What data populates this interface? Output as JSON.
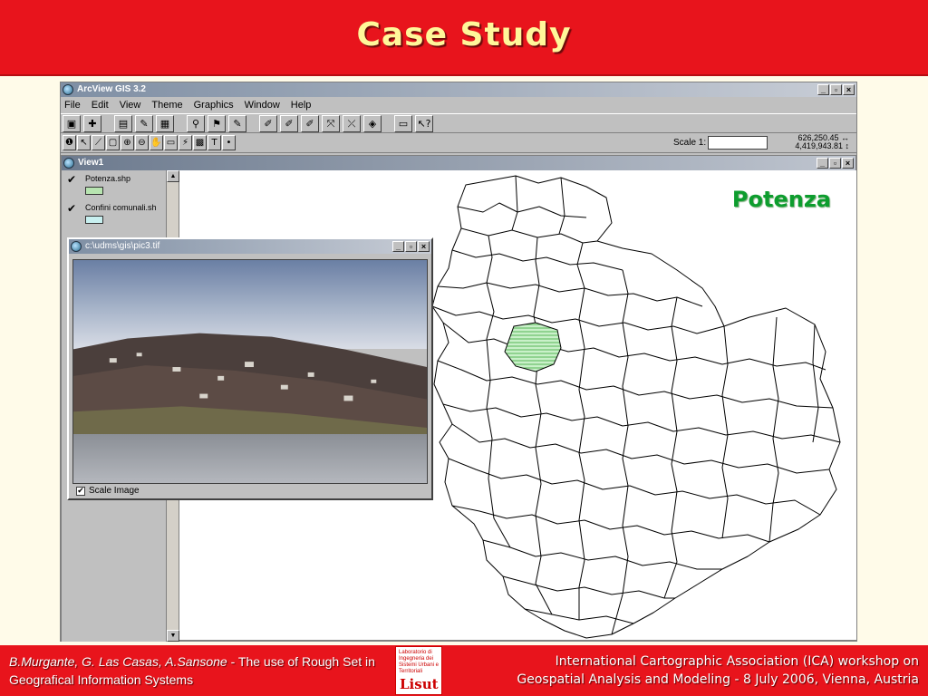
{
  "slide": {
    "title": "Case Study",
    "footer_authors": "B.Murgante, G. Las Casas, A.Sansone",
    "footer_title_part": " - The use of Rough Set in Geografical Information Systems",
    "footer_logo_text": "Laboratorio di Ingegneria dei Sistemi Urbani e Territoriali",
    "footer_logo_mark": "Lisut",
    "footer_right_line1": "International Cartographic Association (ICA) workshop  on",
    "footer_right_line2": "Geospatial Analysis and Modeling - 8 July 2006, Vienna, Austria"
  },
  "app": {
    "title": "ArcView GIS 3.2",
    "window_buttons": [
      "_",
      "▫",
      "×"
    ],
    "menu": [
      {
        "label": "File"
      },
      {
        "label": "Edit"
      },
      {
        "label": "View"
      },
      {
        "label": "Theme"
      },
      {
        "label": "Graphics"
      },
      {
        "label": "Window"
      },
      {
        "label": "Help"
      }
    ],
    "toolbar1_icons": [
      "save-icon",
      "add-theme-icon",
      "theme-properties-icon",
      "edit-legend-icon",
      "open-table-icon",
      "find-icon",
      "locate-address-icon",
      "query-builder-icon",
      "zoom-to-themes-icon",
      "zoom-to-selected-icon",
      "zoom-in-icon",
      "zoom-out-icon",
      "zoom-previous-icon",
      "select-features-icon",
      "clear-selection-icon",
      "help-icon"
    ],
    "toolbar1_glyphs": [
      "▣",
      "✚",
      "▤",
      "✎",
      "▦",
      "⚲",
      "⚑",
      "✎",
      "✐",
      "✐",
      "✐",
      "⤧",
      "⤫",
      "◈",
      "▭",
      "↖?"
    ],
    "toolbar2_icons": [
      "identify-icon",
      "pointer-icon",
      "vertex-edit-icon",
      "select-feature-icon",
      "zoom-in-tool-icon",
      "zoom-out-tool-icon",
      "pan-icon",
      "measure-icon",
      "hotlink-icon",
      "area-of-interest-icon",
      "text-icon",
      "draw-point-icon"
    ],
    "toolbar2_glyphs": [
      "❶",
      "↖",
      "⟋",
      "▢",
      "⊕",
      "⊖",
      "✋",
      "▭",
      "⚡",
      "▩",
      "T",
      "•"
    ],
    "scale_label": "Scale 1:",
    "scale_value": "",
    "coord_x": "626,250.45",
    "coord_y": "4,419,943.81",
    "coord_x_arrow": "↔",
    "coord_y_arrow": "↕"
  },
  "view": {
    "title": "View1",
    "themes": [
      {
        "name": "Potenza.shp",
        "checked": true,
        "color": "#b7e4b0"
      },
      {
        "name": "Confini comunali.sh",
        "checked": true,
        "color": "#c8f0f0"
      }
    ],
    "map_label": "Potenza",
    "highlight_color": "#9be39b"
  },
  "image_window": {
    "title": "c:\\udms\\gis\\pic3.tif",
    "scale_image_label": "Scale Image",
    "scale_image_checked": true
  }
}
